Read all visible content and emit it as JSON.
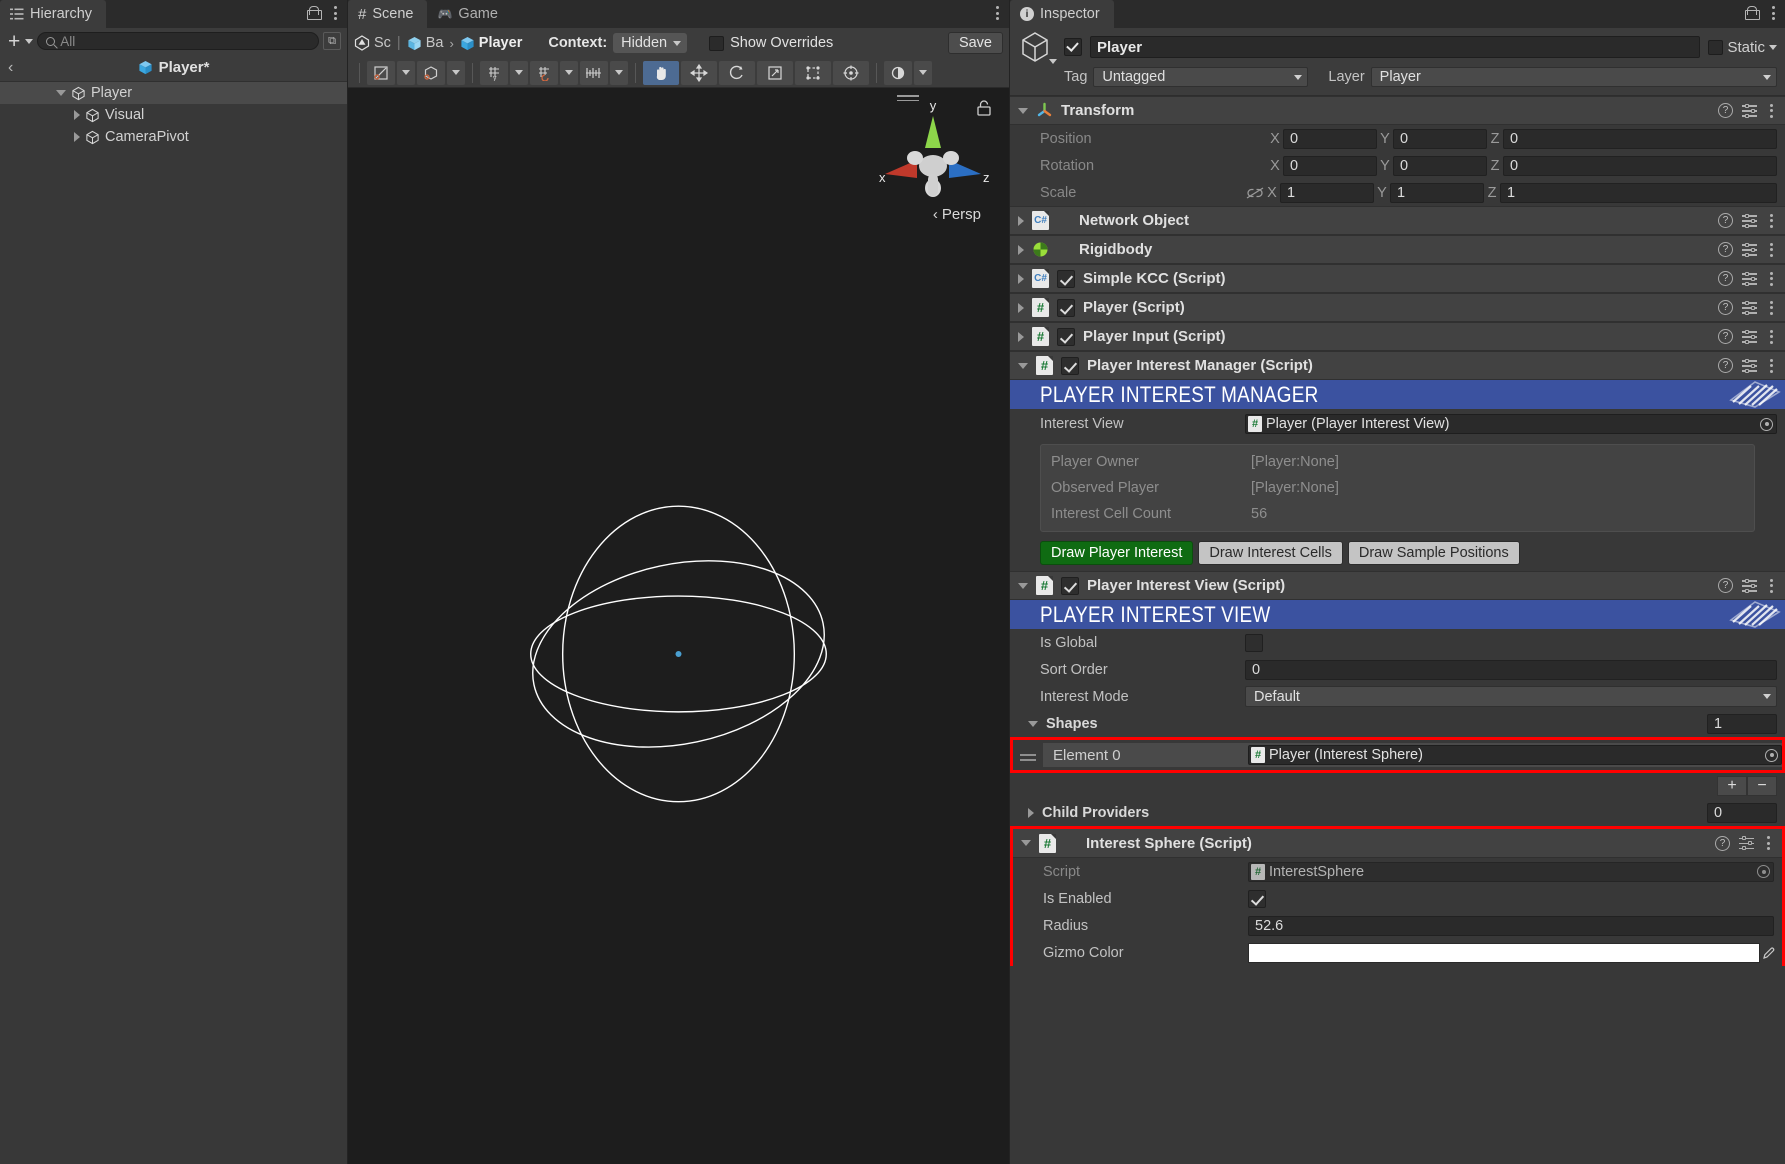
{
  "hierarchy": {
    "tab_label": "Hierarchy",
    "search_placeholder": "All",
    "breadcrumb_title": "Player*",
    "add_label": "+",
    "tree": [
      {
        "label": "Player",
        "depth": 0,
        "expanded": true,
        "selected": true
      },
      {
        "label": "Visual",
        "depth": 1,
        "expanded": false,
        "selected": false
      },
      {
        "label": "CameraPivot",
        "depth": 1,
        "expanded": false,
        "selected": false
      }
    ]
  },
  "scene": {
    "tabs": [
      {
        "label": "Scene",
        "icon": "grid-icon",
        "active": true
      },
      {
        "label": "Game",
        "icon": "gamepad-icon",
        "active": false
      }
    ],
    "breadcrumb": [
      {
        "label": "Sc",
        "icon": "unity-icon"
      },
      {
        "label": "Ba",
        "icon": "prefab-icon"
      },
      {
        "label": "Player",
        "icon": "cube-icon"
      }
    ],
    "context_label": "Context:",
    "context_value": "Hidden",
    "show_overrides_label": "Show Overrides",
    "show_overrides_checked": false,
    "save_label": "Save",
    "tools": [
      {
        "name": "draw-mode-dropdown",
        "glyph": "◩",
        "active": false,
        "arrow": true
      },
      {
        "name": "2d-3d-dropdown",
        "glyph": "⬡",
        "active": false,
        "arrow": true
      },
      {
        "name": "grid-visibility",
        "glyph": "⊞",
        "active": false,
        "arrow": true
      },
      {
        "name": "grid-snapping",
        "glyph": "⌗",
        "active": false,
        "arrow": true
      },
      {
        "name": "snap-increment",
        "glyph": "|||",
        "active": false,
        "arrow": true
      },
      {
        "name": "hand-tool",
        "glyph": "✋",
        "active": true,
        "arrow": false
      },
      {
        "name": "move-tool",
        "glyph": "✥",
        "active": false,
        "arrow": false
      },
      {
        "name": "rotate-tool",
        "glyph": "⟳",
        "active": false,
        "arrow": false
      },
      {
        "name": "scale-tool",
        "glyph": "⤢",
        "active": false,
        "arrow": false
      },
      {
        "name": "rect-tool",
        "glyph": "⬚",
        "active": false,
        "arrow": false
      },
      {
        "name": "transform-tool",
        "glyph": "✣",
        "active": false,
        "arrow": false
      },
      {
        "name": "custom-tool",
        "glyph": "◐",
        "active": false,
        "arrow": true
      }
    ],
    "gizmo": {
      "axis_x": "x",
      "axis_y": "y",
      "axis_z": "z",
      "perspective_label": "Persp"
    }
  },
  "inspector": {
    "tab_label": "Inspector",
    "object_name": "Player",
    "object_enabled": true,
    "static_label": "Static",
    "static_checked": false,
    "tag_label": "Tag",
    "tag_value": "Untagged",
    "layer_label": "Layer",
    "layer_value": "Player",
    "transform": {
      "title": "Transform",
      "rows": [
        {
          "label": "Position",
          "x": "0",
          "y": "0",
          "z": "0",
          "link": false
        },
        {
          "label": "Rotation",
          "x": "0",
          "y": "0",
          "z": "0",
          "link": false
        },
        {
          "label": "Scale",
          "x": "1",
          "y": "1",
          "z": "1",
          "link": true
        }
      ],
      "axis_x": "X",
      "axis_y": "Y",
      "axis_z": "Z"
    },
    "components": [
      {
        "title": "Network Object",
        "icon": "cs-script-icon",
        "expanded": false,
        "has_toggle": false,
        "enabled": false
      },
      {
        "title": "Rigidbody",
        "icon": "rigidbody-icon",
        "expanded": false,
        "has_toggle": false,
        "enabled": false
      },
      {
        "title": "Simple KCC (Script)",
        "icon": "cs-script-icon",
        "expanded": false,
        "has_toggle": true,
        "enabled": true
      },
      {
        "title": "Player (Script)",
        "icon": "hash-script-icon",
        "expanded": false,
        "has_toggle": true,
        "enabled": true
      },
      {
        "title": "Player Input (Script)",
        "icon": "hash-script-icon",
        "expanded": false,
        "has_toggle": true,
        "enabled": true
      },
      {
        "title": "Player Interest Manager (Script)",
        "icon": "hash-script-icon",
        "expanded": true,
        "has_toggle": true,
        "enabled": true
      }
    ],
    "interest_manager": {
      "banner": "PLAYER INTEREST MANAGER",
      "interest_view_label": "Interest View",
      "interest_view_value": "Player (Player Interest View)",
      "readonly_rows": [
        {
          "label": "Player Owner",
          "value": "[Player:None]"
        },
        {
          "label": "Observed Player",
          "value": "[Player:None]"
        },
        {
          "label": "Interest Cell Count",
          "value": "56"
        }
      ],
      "buttons": [
        {
          "label": "Draw Player Interest",
          "active": true
        },
        {
          "label": "Draw Interest Cells",
          "active": false
        },
        {
          "label": "Draw Sample Positions",
          "active": false
        }
      ]
    },
    "interest_view_component": {
      "title": "Player Interest View (Script)",
      "enabled": true,
      "banner": "PLAYER INTEREST VIEW",
      "is_global_label": "Is Global",
      "is_global_checked": false,
      "sort_order_label": "Sort Order",
      "sort_order_value": "0",
      "interest_mode_label": "Interest Mode",
      "interest_mode_value": "Default",
      "shapes_label": "Shapes",
      "shapes_count": "1",
      "element_label": "Element 0",
      "element_value": "Player (Interest Sphere)",
      "add_label": "+",
      "remove_label": "−",
      "child_providers_label": "Child Providers",
      "child_providers_count": "0"
    },
    "interest_sphere": {
      "title": "Interest Sphere (Script)",
      "script_label": "Script",
      "script_value": "InterestSphere",
      "is_enabled_label": "Is Enabled",
      "is_enabled_checked": true,
      "radius_label": "Radius",
      "radius_value": "52.6",
      "gizmo_color_label": "Gizmo Color",
      "gizmo_color_value": "#FFFFFF"
    }
  },
  "colors": {
    "banner_blue": "#3b52a0",
    "highlight_red": "#ff0000",
    "active_green": "#0f6b12",
    "accent_blue": "#4d6b93"
  }
}
